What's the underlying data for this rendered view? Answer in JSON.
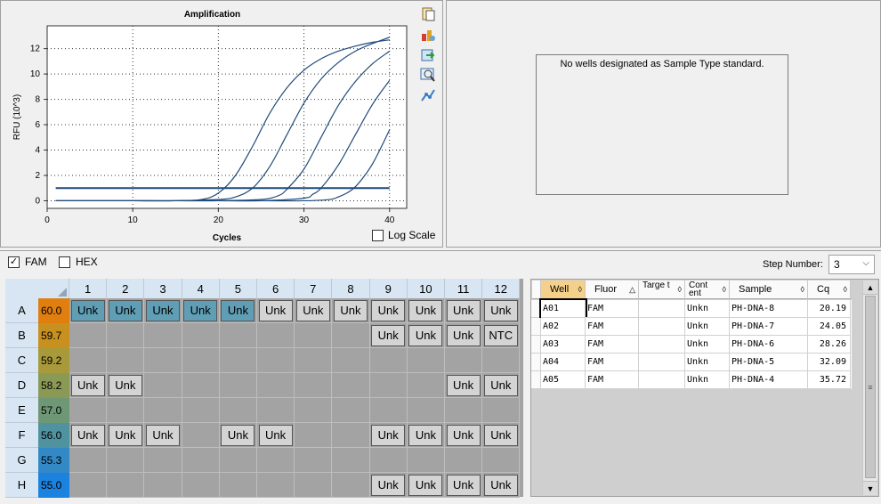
{
  "chart": {
    "title": "Amplification",
    "xlabel": "Cycles",
    "ylabel": "RFU (10^3)",
    "log_scale_label": "Log Scale",
    "x_ticks": [
      "0",
      "10",
      "20",
      "30",
      "40"
    ],
    "y_ticks": [
      "0",
      "2",
      "4",
      "6",
      "8",
      "10",
      "12"
    ]
  },
  "chart_data": {
    "type": "line",
    "title": "Amplification",
    "xlabel": "Cycles",
    "ylabel": "RFU (10^3)",
    "xlim": [
      0,
      42
    ],
    "ylim": [
      -0.6,
      13.8
    ],
    "grid": true,
    "series": [
      {
        "cq": 20.19,
        "threshold": 1.0,
        "plateau": 12.9,
        "x": [
          1,
          5,
          10,
          15,
          18,
          20,
          22,
          24,
          26,
          28,
          30,
          32,
          34,
          36,
          38,
          40
        ],
        "y": [
          0.0,
          0.0,
          0.0,
          0.0,
          0.1,
          0.6,
          2.0,
          4.3,
          6.9,
          8.9,
          10.3,
          11.2,
          11.8,
          12.2,
          12.5,
          12.7
        ]
      },
      {
        "cq": 24.05,
        "x": [
          1,
          5,
          10,
          15,
          20,
          22,
          24,
          26,
          28,
          30,
          32,
          34,
          36,
          38,
          40
        ],
        "y": [
          0.0,
          0.0,
          0.0,
          0.0,
          0.1,
          0.3,
          1.0,
          2.7,
          5.2,
          7.7,
          9.6,
          10.9,
          11.8,
          12.4,
          12.9
        ]
      },
      {
        "cq": 28.26,
        "x": [
          1,
          5,
          10,
          15,
          20,
          25,
          27,
          28,
          30,
          32,
          34,
          36,
          38,
          40
        ],
        "y": [
          0.0,
          0.0,
          0.0,
          0.0,
          0.0,
          0.1,
          0.4,
          0.9,
          2.5,
          5.0,
          7.5,
          9.4,
          10.8,
          11.8
        ]
      },
      {
        "cq": 32.09,
        "x": [
          1,
          5,
          10,
          15,
          20,
          25,
          30,
          31,
          32,
          34,
          36,
          38,
          40
        ],
        "y": [
          0.0,
          0.0,
          0.0,
          0.0,
          0.0,
          0.0,
          0.2,
          0.5,
          1.0,
          2.8,
          5.2,
          7.6,
          9.5
        ]
      },
      {
        "cq": 35.72,
        "x": [
          1,
          5,
          10,
          15,
          20,
          25,
          30,
          33,
          34,
          35,
          36,
          37,
          38,
          39,
          40
        ],
        "y": [
          0.0,
          0.0,
          0.0,
          0.0,
          0.0,
          0.0,
          0.0,
          0.1,
          0.3,
          0.6,
          1.1,
          1.9,
          2.9,
          4.2,
          5.6
        ]
      }
    ],
    "threshold_line": 1.0
  },
  "standard_curve": {
    "message": "No wells designated as Sample Type standard."
  },
  "fluors": [
    {
      "label": "FAM",
      "checked": true
    },
    {
      "label": "HEX",
      "checked": false
    }
  ],
  "step": {
    "label": "Step Number:",
    "value": "3"
  },
  "plate": {
    "columns": [
      "1",
      "2",
      "3",
      "4",
      "5",
      "6",
      "7",
      "8",
      "9",
      "10",
      "11",
      "12"
    ],
    "rows": [
      {
        "label": "A",
        "temp": "60.0",
        "color": "#e07f10",
        "wells": [
          "Unk",
          "Unk",
          "Unk",
          "Unk",
          "Unk",
          "Unk",
          "Unk",
          "Unk",
          "Unk",
          "Unk",
          "Unk",
          "Unk"
        ],
        "selected": [
          1,
          1,
          1,
          1,
          1,
          0,
          0,
          0,
          0,
          0,
          0,
          0
        ]
      },
      {
        "label": "B",
        "temp": "59.7",
        "color": "#c8901e",
        "wells": [
          "",
          "",
          "",
          "",
          "",
          "",
          "",
          "",
          "Unk",
          "Unk",
          "Unk",
          "NTC"
        ],
        "selected": [
          0,
          0,
          0,
          0,
          0,
          0,
          0,
          0,
          0,
          0,
          0,
          0
        ]
      },
      {
        "label": "C",
        "temp": "59.2",
        "color": "#a89a3a",
        "wells": [
          "",
          "",
          "",
          "",
          "",
          "",
          "",
          "",
          "",
          "",
          "",
          ""
        ],
        "selected": [
          0,
          0,
          0,
          0,
          0,
          0,
          0,
          0,
          0,
          0,
          0,
          0
        ]
      },
      {
        "label": "D",
        "temp": "58.2",
        "color": "#8a9a54",
        "wells": [
          "Unk",
          "Unk",
          "",
          "",
          "",
          "",
          "",
          "",
          "",
          "",
          "Unk",
          "Unk"
        ],
        "selected": [
          0,
          0,
          0,
          0,
          0,
          0,
          0,
          0,
          0,
          0,
          0,
          0
        ]
      },
      {
        "label": "E",
        "temp": "57.0",
        "color": "#6e9776",
        "wells": [
          "",
          "",
          "",
          "",
          "",
          "",
          "",
          "",
          "",
          "",
          "",
          ""
        ],
        "selected": [
          0,
          0,
          0,
          0,
          0,
          0,
          0,
          0,
          0,
          0,
          0,
          0
        ]
      },
      {
        "label": "F",
        "temp": "56.0",
        "color": "#4f92a0",
        "wells": [
          "Unk",
          "Unk",
          "Unk",
          "",
          "Unk",
          "Unk",
          "",
          "",
          "Unk",
          "Unk",
          "Unk",
          "Unk"
        ],
        "selected": [
          0,
          0,
          0,
          0,
          0,
          0,
          0,
          0,
          0,
          0,
          0,
          0
        ]
      },
      {
        "label": "G",
        "temp": "55.3",
        "color": "#3389c6",
        "wells": [
          "",
          "",
          "",
          "",
          "",
          "",
          "",
          "",
          "",
          "",
          "",
          ""
        ],
        "selected": [
          0,
          0,
          0,
          0,
          0,
          0,
          0,
          0,
          0,
          0,
          0,
          0
        ]
      },
      {
        "label": "H",
        "temp": "55.0",
        "color": "#1c82e0",
        "wells": [
          "",
          "",
          "",
          "",
          "",
          "",
          "",
          "",
          "Unk",
          "Unk",
          "Unk",
          "Unk"
        ],
        "selected": [
          0,
          0,
          0,
          0,
          0,
          0,
          0,
          0,
          0,
          0,
          0,
          0
        ]
      }
    ]
  },
  "results_table": {
    "headers": [
      "Well",
      "Fluor",
      "Targe t",
      "Cont ent",
      "Sample",
      "Cq"
    ],
    "rows": [
      {
        "well": "A01",
        "fluor": "FAM",
        "target": "",
        "content": "Unkn",
        "sample": "PH-DNA-8",
        "cq": "20.19"
      },
      {
        "well": "A02",
        "fluor": "FAM",
        "target": "",
        "content": "Unkn",
        "sample": "PH-DNA-7",
        "cq": "24.05"
      },
      {
        "well": "A03",
        "fluor": "FAM",
        "target": "",
        "content": "Unkn",
        "sample": "PH-DNA-6",
        "cq": "28.26"
      },
      {
        "well": "A04",
        "fluor": "FAM",
        "target": "",
        "content": "Unkn",
        "sample": "PH-DNA-5",
        "cq": "32.09"
      },
      {
        "well": "A05",
        "fluor": "FAM",
        "target": "",
        "content": "Unkn",
        "sample": "PH-DNA-4",
        "cq": "35.72"
      }
    ]
  },
  "colors": {
    "curve": "#1f4a7a",
    "plate_bg": "#a3a3a3",
    "selected_well": "#5f9eb4",
    "header_bg": "#d8e6f3",
    "accent_header": "#f5d08a"
  }
}
